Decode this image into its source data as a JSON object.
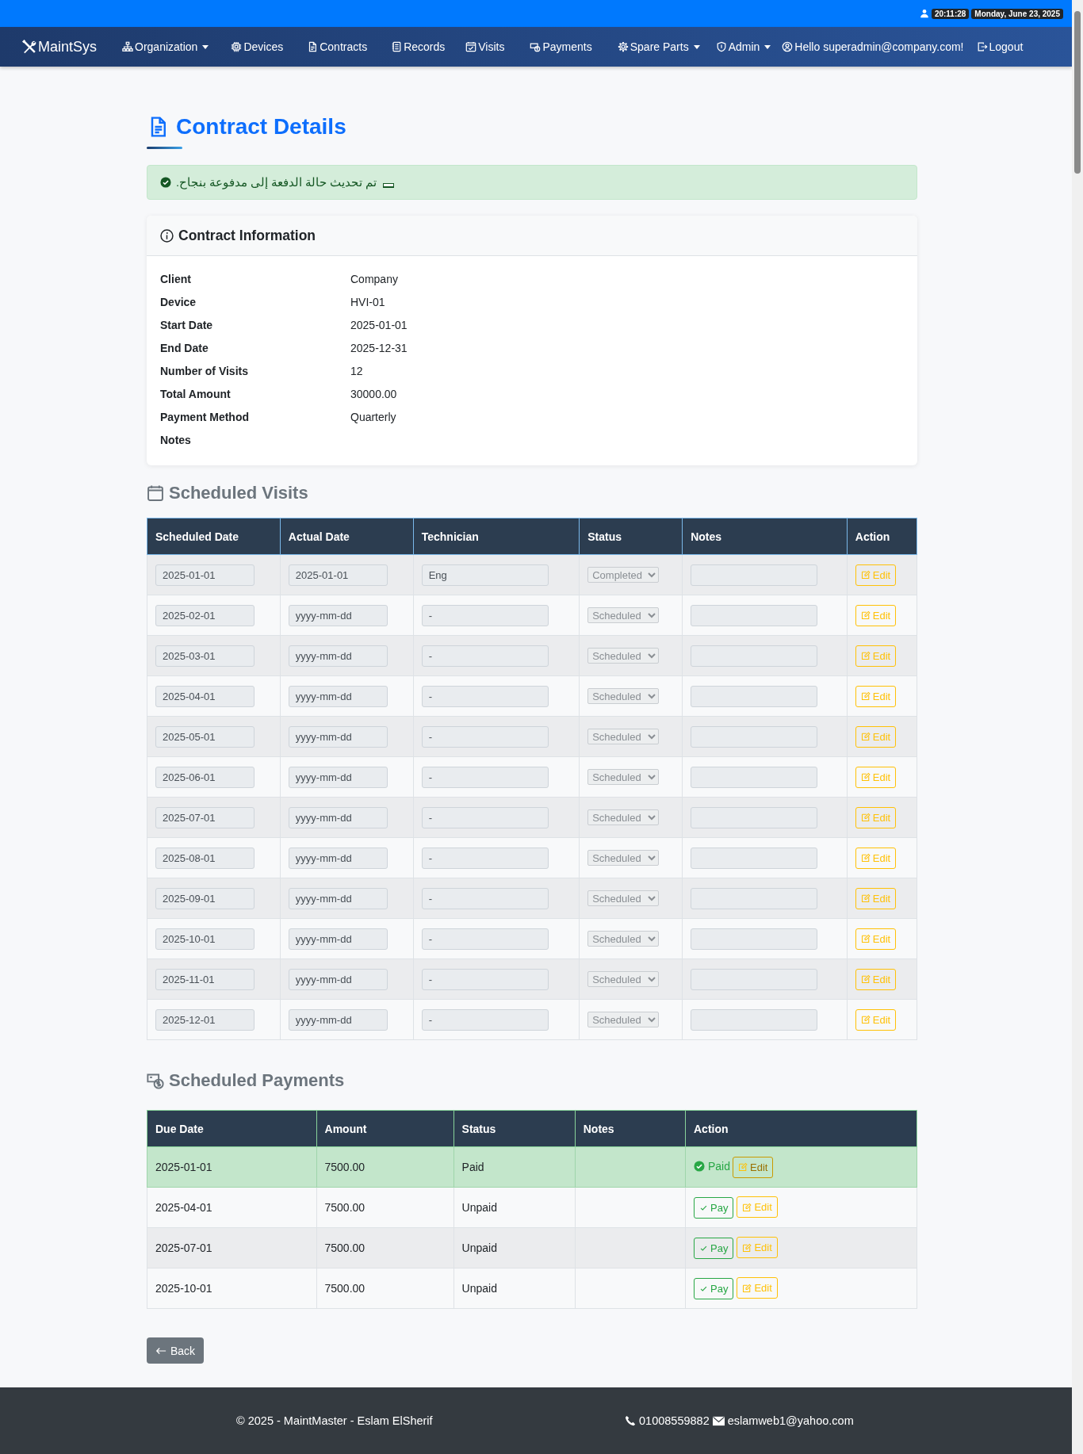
{
  "topbar": {
    "time": "20:11:28",
    "date": "Monday, June 23, 2025"
  },
  "navbar": {
    "brand": "MaintSys",
    "items": [
      {
        "label": "Organization",
        "dropdown": true
      },
      {
        "label": "Devices",
        "dropdown": false
      },
      {
        "label": "Contracts",
        "dropdown": false
      },
      {
        "label": "Records",
        "dropdown": false
      },
      {
        "label": "Visits",
        "dropdown": false
      },
      {
        "label": "Payments",
        "dropdown": false
      },
      {
        "label": "Spare Parts",
        "dropdown": true
      },
      {
        "label": "Admin",
        "dropdown": true
      },
      {
        "label": "Hello superadmin@company.com!",
        "dropdown": false
      },
      {
        "label": "Logout",
        "dropdown": false
      }
    ]
  },
  "page_title": "Contract Details",
  "alert": {
    "message": "تم تحديث حالة الدفعة إلى مدفوعة بنجاح."
  },
  "contract_information": {
    "title": "Contract Information",
    "fields": [
      {
        "label": "Client",
        "value": "Company"
      },
      {
        "label": "Device",
        "value": "HVI-01"
      },
      {
        "label": "Start Date",
        "value": "2025-01-01"
      },
      {
        "label": "End Date",
        "value": "2025-12-31"
      },
      {
        "label": "Number of Visits",
        "value": "12"
      },
      {
        "label": "Total Amount",
        "value": "30000.00"
      },
      {
        "label": "Payment Method",
        "value": "Quarterly"
      },
      {
        "label": "Notes"
      }
    ]
  },
  "scheduled_visits": {
    "title": "Scheduled Visits",
    "columns": [
      "Scheduled Date",
      "Actual Date",
      "Technician",
      "Status",
      "Notes",
      "Action"
    ],
    "rows": [
      {
        "scheduled_date": "2025-01-01",
        "actual_date": "2025-01-01",
        "technician": "Eng",
        "status": "Completed",
        "action": "Edit"
      },
      {
        "scheduled_date": "2025-02-01",
        "actual_date_placeholder": "yyyy-mm-dd",
        "technician": "-",
        "status": "Scheduled",
        "action": "Edit"
      },
      {
        "scheduled_date": "2025-03-01",
        "actual_date_placeholder": "yyyy-mm-dd",
        "technician": "-",
        "status": "Scheduled",
        "action": "Edit"
      },
      {
        "scheduled_date": "2025-04-01",
        "actual_date_placeholder": "yyyy-mm-dd",
        "technician": "-",
        "status": "Scheduled",
        "action": "Edit"
      },
      {
        "scheduled_date": "2025-05-01",
        "actual_date_placeholder": "yyyy-mm-dd",
        "technician": "-",
        "status": "Scheduled",
        "action": "Edit"
      },
      {
        "scheduled_date": "2025-06-01",
        "actual_date_placeholder": "yyyy-mm-dd",
        "technician": "-",
        "status": "Scheduled",
        "action": "Edit"
      },
      {
        "scheduled_date": "2025-07-01",
        "actual_date_placeholder": "yyyy-mm-dd",
        "technician": "-",
        "status": "Scheduled",
        "action": "Edit"
      },
      {
        "scheduled_date": "2025-08-01",
        "actual_date_placeholder": "yyyy-mm-dd",
        "technician": "-",
        "status": "Scheduled",
        "action": "Edit"
      },
      {
        "scheduled_date": "2025-09-01",
        "actual_date_placeholder": "yyyy-mm-dd",
        "technician": "-",
        "status": "Scheduled",
        "action": "Edit"
      },
      {
        "scheduled_date": "2025-10-01",
        "actual_date_placeholder": "yyyy-mm-dd",
        "technician": "-",
        "status": "Scheduled",
        "action": "Edit"
      },
      {
        "scheduled_date": "2025-11-01",
        "actual_date_placeholder": "yyyy-mm-dd",
        "technician": "-",
        "status": "Scheduled",
        "action": "Edit"
      },
      {
        "scheduled_date": "2025-12-01",
        "actual_date_placeholder": "yyyy-mm-dd",
        "technician": "-",
        "status": "Scheduled",
        "action": "Edit"
      }
    ]
  },
  "scheduled_payments": {
    "title": "Scheduled Payments",
    "columns": [
      "Due Date",
      "Amount",
      "Status",
      "Notes",
      "Action"
    ],
    "rows": [
      {
        "due_date": "2025-01-01",
        "amount": "7500.00",
        "status": "Paid",
        "paid": true,
        "action": "Paid",
        "edit": "Edit"
      },
      {
        "due_date": "2025-04-01",
        "amount": "7500.00",
        "status": "Unpaid",
        "paid": false,
        "action": "Pay",
        "edit": "Edit"
      },
      {
        "due_date": "2025-07-01",
        "amount": "7500.00",
        "status": "Unpaid",
        "paid": false,
        "action": "Pay",
        "edit": "Edit"
      },
      {
        "due_date": "2025-10-01",
        "amount": "7500.00",
        "status": "Unpaid",
        "paid": false,
        "action": "Pay",
        "edit": "Edit"
      }
    ]
  },
  "back_button": "Back",
  "footer": {
    "copyright": "© 2025 - MaintMaster - Eslam ElSherif",
    "phone": "01008559882",
    "email": "eslamweb1@yahoo.com"
  }
}
